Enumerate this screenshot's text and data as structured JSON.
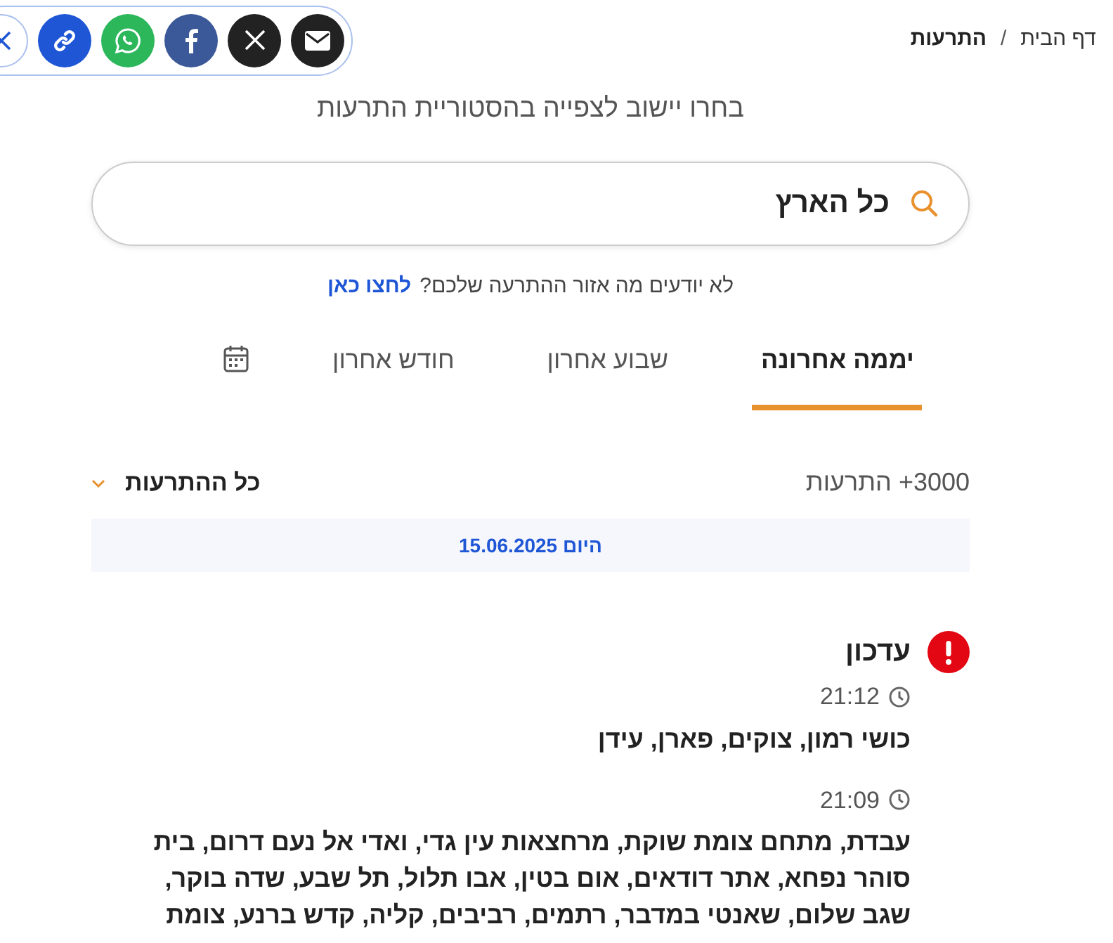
{
  "breadcrumb": [
    {
      "label": "דף הבית",
      "current": false
    },
    {
      "label": "התרעות",
      "current": true
    }
  ],
  "breadcrumb_separator": "/",
  "share": [
    {
      "kind": "email"
    },
    {
      "kind": "x"
    },
    {
      "kind": "facebook"
    },
    {
      "kind": "whatsapp"
    },
    {
      "kind": "link"
    },
    {
      "kind": "close"
    }
  ],
  "heading": "בחרו יישוב לצפייה בהסטוריית התרעות",
  "search": {
    "value": "כל הארץ"
  },
  "hint": {
    "text": "לא יודעים מה אזור ההתרעה שלכם?",
    "link": "לחצו כאן"
  },
  "tabs": [
    {
      "label": "יממה אחרונה",
      "selected": true
    },
    {
      "label": "שבוע אחרון",
      "selected": false
    },
    {
      "label": "חודש אחרון",
      "selected": false
    }
  ],
  "count": "3000+ התרעות",
  "filter": "כל ההתרעות",
  "date_bar": "היום 15.06.2025",
  "alert": {
    "title": "עדכון",
    "entries": [
      {
        "time": "21:12",
        "text": "כושי רמון, צוקים, פארן, עידן"
      },
      {
        "time": "21:09",
        "text": "עבדת, מתחם צומת שוקת, מרחצאות עין גדי, ואדי אל נעם דרום, בית סוהר נפחא, אתר דודאים, אום בטין, אבו תלול, תל שבע, שדה בוקר, שגב שלום, שאנטי במדבר, רתמים, רביבים, קליה, קדש ברנע, צומת"
      }
    ]
  }
}
